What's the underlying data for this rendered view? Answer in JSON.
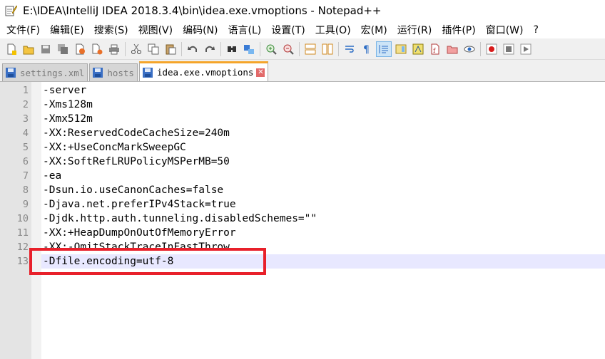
{
  "window": {
    "title": "E:\\IDEA\\IntelliJ IDEA 2018.3.4\\bin\\idea.exe.vmoptions - Notepad++"
  },
  "menu": [
    "文件(F)",
    "编辑(E)",
    "搜索(S)",
    "视图(V)",
    "编码(N)",
    "语言(L)",
    "设置(T)",
    "工具(O)",
    "宏(M)",
    "运行(R)",
    "插件(P)",
    "窗口(W)",
    "?"
  ],
  "toolbar": {
    "icons": [
      "new-file-icon",
      "open-file-icon",
      "save-icon",
      "save-all-icon",
      "close-icon",
      "close-all-icon",
      "print-icon",
      "cut-icon",
      "copy-icon",
      "paste-icon",
      "undo-icon",
      "redo-icon",
      "find-icon",
      "replace-icon",
      "zoom-in-icon",
      "zoom-out-icon",
      "sync-vertical-icon",
      "sync-horizontal-icon",
      "word-wrap-icon",
      "show-all-chars-icon",
      "indent-guide-icon",
      "document-map-icon",
      "function-list-icon",
      "folder-workspace-icon",
      "monitoring-icon",
      "record-macro-icon",
      "stop-macro-icon",
      "play-macro-icon"
    ],
    "colors": {
      "accent": "#2b6cc4",
      "record": "#d81b1b"
    }
  },
  "tabs": [
    {
      "label": "settings.xml",
      "active": false
    },
    {
      "label": "hosts",
      "active": false
    },
    {
      "label": "idea.exe.vmoptions",
      "active": true
    }
  ],
  "editor": {
    "current_line": 13,
    "lines": [
      {
        "num": "1",
        "text": "-server"
      },
      {
        "num": "2",
        "text": "-Xms128m"
      },
      {
        "num": "3",
        "text": "-Xmx512m"
      },
      {
        "num": "4",
        "text": "-XX:ReservedCodeCacheSize=240m"
      },
      {
        "num": "5",
        "text": "-XX:+UseConcMarkSweepGC"
      },
      {
        "num": "6",
        "text": "-XX:SoftRefLRUPolicyMSPerMB=50"
      },
      {
        "num": "7",
        "text": "-ea"
      },
      {
        "num": "8",
        "text": "-Dsun.io.useCanonCaches=false"
      },
      {
        "num": "9",
        "text": "-Djava.net.preferIPv4Stack=true"
      },
      {
        "num": "10",
        "text": "-Djdk.http.auth.tunneling.disabledSchemes=\"\""
      },
      {
        "num": "11",
        "text": "-XX:+HeapDumpOnOutOfMemoryError"
      },
      {
        "num": "12",
        "text": "-XX:-OmitStackTraceInFastThrow"
      },
      {
        "num": "13",
        "text": "-Dfile.encoding=utf-8"
      }
    ],
    "annotation_color": "#e8202a"
  }
}
